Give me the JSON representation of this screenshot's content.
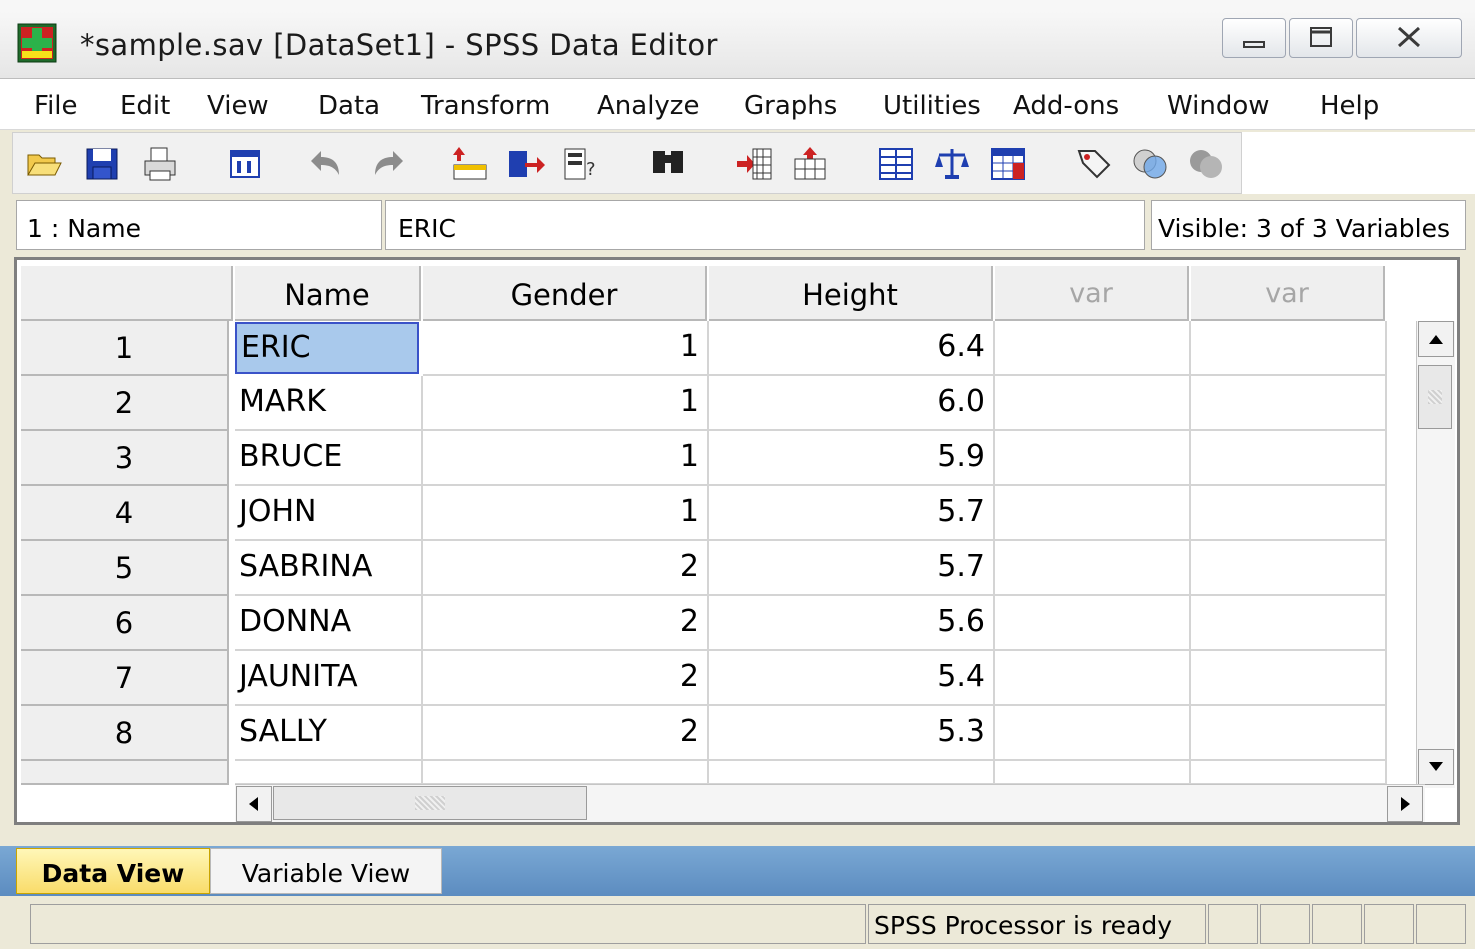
{
  "window": {
    "title": "*sample.sav [DataSet1] - SPSS Data Editor"
  },
  "menu": [
    "File",
    "Edit",
    "View",
    "Data",
    "Transform",
    "Analyze",
    "Graphs",
    "Utilities",
    "Add-ons",
    "Window",
    "Help"
  ],
  "toolbar": {
    "icons": [
      "open-icon",
      "save-icon",
      "print-icon",
      "dialog-recall-icon",
      "undo-icon",
      "redo-icon",
      "goto-case-icon",
      "goto-variable-icon",
      "variables-info-icon",
      "find-icon",
      "insert-cases-icon",
      "insert-variable-icon",
      "split-file-icon",
      "weight-cases-icon",
      "select-cases-icon",
      "value-labels-icon",
      "use-sets-icon",
      "show-all-variables-icon"
    ]
  },
  "editor": {
    "cell_ref": "1 : Name",
    "cell_value": "ERIC",
    "visible": "Visible: 3 of 3 Variables"
  },
  "grid": {
    "columns": [
      "Name",
      "Gender",
      "Height",
      "var",
      "var"
    ],
    "rows": [
      {
        "n": "1",
        "name": "ERIC",
        "gender": "1",
        "height": "6.4"
      },
      {
        "n": "2",
        "name": "MARK",
        "gender": "1",
        "height": "6.0"
      },
      {
        "n": "3",
        "name": "BRUCE",
        "gender": "1",
        "height": "5.9"
      },
      {
        "n": "4",
        "name": "JOHN",
        "gender": "1",
        "height": "5.7"
      },
      {
        "n": "5",
        "name": "SABRINA",
        "gender": "2",
        "height": "5.7"
      },
      {
        "n": "6",
        "name": "DONNA",
        "gender": "2",
        "height": "5.6"
      },
      {
        "n": "7",
        "name": "JAUNITA",
        "gender": "2",
        "height": "5.4"
      },
      {
        "n": "8",
        "name": "SALLY",
        "gender": "2",
        "height": "5.3"
      }
    ]
  },
  "tabs": {
    "data_view": "Data View",
    "variable_view": "Variable View"
  },
  "status": {
    "text": "SPSS  Processor is ready"
  },
  "colors": {
    "selected_cell": "#a9c9ec",
    "selection_border": "#3a52c8",
    "tab_active": "#f9dc6a",
    "tabbar": "#5c8cc0"
  }
}
